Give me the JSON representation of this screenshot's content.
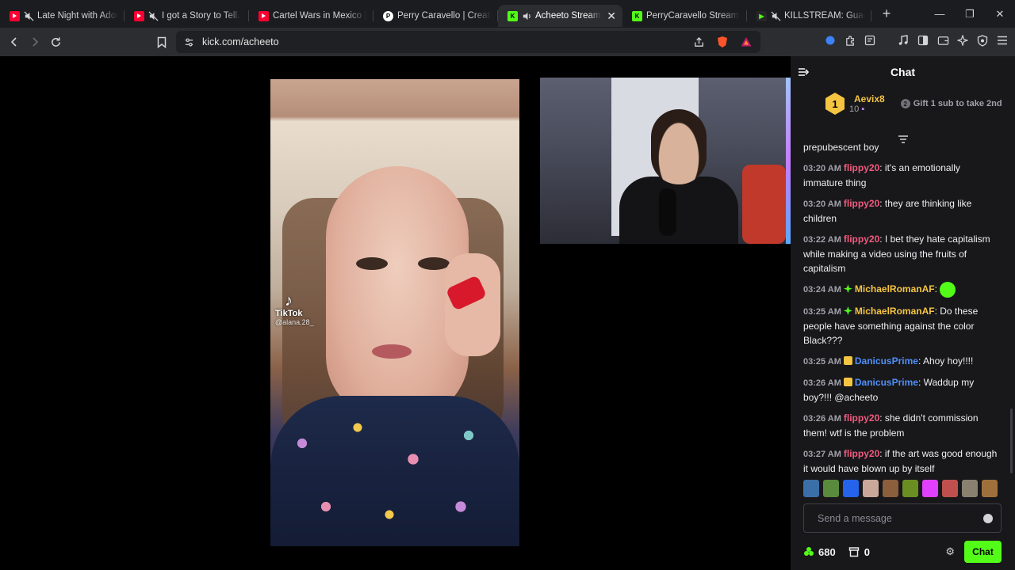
{
  "tabs": [
    {
      "title": "Late Night with Adoni",
      "favicon": "youtube-icon",
      "muted": true,
      "active": false
    },
    {
      "title": "I got a Story to Tell. - Y",
      "favicon": "youtube-icon",
      "muted": true,
      "active": false
    },
    {
      "title": "Cartel Wars in Mexico | JF",
      "favicon": "youtube-icon",
      "muted": false,
      "active": false
    },
    {
      "title": "Perry Caravello | Creating",
      "favicon": "patreon-icon",
      "muted": false,
      "active": false
    },
    {
      "title": "Acheeto Stream - W",
      "favicon": "kick-icon",
      "muted": false,
      "active": true,
      "close": "✕"
    },
    {
      "title": "PerryCaravello Stream - W",
      "favicon": "kick-icon",
      "muted": false,
      "active": false
    },
    {
      "title": "KILLSTREAM: Guadalaj",
      "favicon": "rumble-icon",
      "muted": true,
      "active": false
    }
  ],
  "new_tab": "+",
  "window_controls": {
    "minimize": "—",
    "maximize": "❐",
    "close": "✕"
  },
  "address": {
    "url": "kick.com/acheeto"
  },
  "video": {
    "tiktok_watermark": "TikTok",
    "tiktok_handle": "@alana.28_"
  },
  "chat": {
    "title": "Chat",
    "pinned": {
      "rank": "1",
      "user": "Aevix8",
      "count": "10",
      "gift_text": "Gift 1 sub to take 2nd"
    },
    "messages": [
      {
        "time": "",
        "user": "",
        "color": "",
        "text": "prepubescent boy",
        "badge": ""
      },
      {
        "time": "03:20 AM",
        "user": "flippy20",
        "color": "#f05a7e",
        "text": "it's an emotionally immature thing",
        "badge": ""
      },
      {
        "time": "03:20 AM",
        "user": "flippy20",
        "color": "#f05a7e",
        "text": "they are thinking like children",
        "badge": ""
      },
      {
        "time": "03:22 AM",
        "user": "flippy20",
        "color": "#f05a7e",
        "text": "I bet they hate capitalism while making a video using the fruits of capitalism",
        "badge": ""
      },
      {
        "time": "03:24 AM",
        "user": "MichaelRomanAF",
        "color": "#f5c542",
        "text": "",
        "badge": "sparkle",
        "emote": true
      },
      {
        "time": "03:25 AM",
        "user": "MichaelRomanAF",
        "color": "#f5c542",
        "text": "Do these people have something against the color Black???",
        "badge": "sparkle"
      },
      {
        "time": "03:25 AM",
        "user": "DanicusPrime",
        "color": "#4f8ff7",
        "text": "Ahoy hoy!!!!",
        "badge": "gift"
      },
      {
        "time": "03:26 AM",
        "user": "DanicusPrime",
        "color": "#4f8ff7",
        "text": "Waddup my boy?!!! @acheeto",
        "badge": "gift"
      },
      {
        "time": "03:26 AM",
        "user": "flippy20",
        "color": "#f05a7e",
        "text": "she didn't commission them! wtf is the problem",
        "badge": ""
      },
      {
        "time": "03:27 AM",
        "user": "flippy20",
        "color": "#f05a7e",
        "text": "if the art was good enough it would have blown up by itself",
        "badge": ""
      }
    ],
    "input_placeholder": "Send a message",
    "points": "680",
    "store_count": "0",
    "send_label": "Chat"
  },
  "colors": {
    "kick_green": "#53fc18",
    "chat_bg": "#18181b",
    "toolbar_bg": "#2c2d31"
  }
}
